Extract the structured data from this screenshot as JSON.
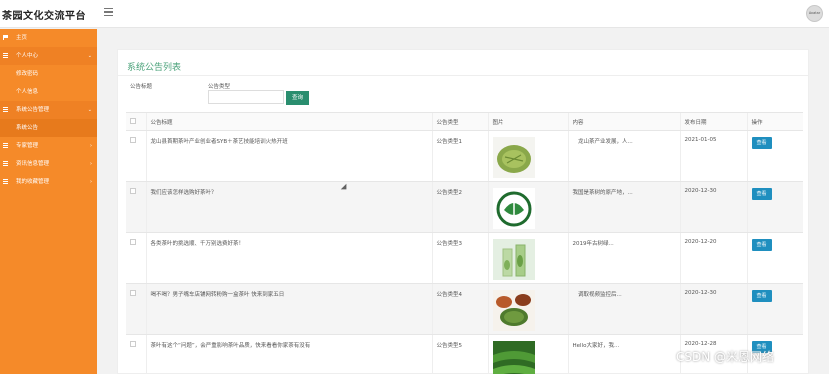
{
  "app": {
    "title": "茶园文化交流平台",
    "avatar_text": "Avatar"
  },
  "sidebar": {
    "items": [
      {
        "label": "主页",
        "icon": "flag-icon"
      },
      {
        "label": "个人中心",
        "icon": "grid-icon",
        "chevron": "⌄"
      },
      {
        "label": "修改密码"
      },
      {
        "label": "个人信息"
      },
      {
        "label": "系统公告管理",
        "icon": "grid-icon",
        "chevron": "⌄"
      },
      {
        "label": "系统公告"
      },
      {
        "label": "专家管理",
        "icon": "grid-icon",
        "chevron": "›"
      },
      {
        "label": "资讯信息管理",
        "icon": "grid-icon",
        "chevron": "›"
      },
      {
        "label": "我的收藏管理",
        "icon": "grid-icon",
        "chevron": "›"
      }
    ]
  },
  "main": {
    "title": "系统公告列表",
    "filters": {
      "title_label": "公告标题",
      "type_label": "公告类型",
      "search_label": "查询"
    },
    "table": {
      "headers": [
        "公告标题",
        "公告类型",
        "图片",
        "内容",
        "发布日期",
        "操作"
      ],
      "action_label": "查看",
      "rows": [
        {
          "title": "龙山县首期茶叶产业创业者SYB＋茶艺技能培训火热开班",
          "type": "公告类型1",
          "content": "　龙山茶产业发展，人...",
          "date": "2021-01-05"
        },
        {
          "title": "我们应该怎样选购好茶叶？",
          "type": "公告类型2",
          "content": "我国是茶树的原产地，...",
          "date": "2020-12-30"
        },
        {
          "title": "各类茶叶的挑选顺、千万别选费好茶！",
          "type": "公告类型3",
          "content": "2019年古树绿...",
          "date": "2020-12-20"
        },
        {
          "title": "喝不喝？男子嘴车店铺网转粉购一盒茶叶 快来到家五日",
          "type": "公告类型4",
          "content": "　调取视频监控后...",
          "date": "2020-12-30"
        },
        {
          "title": "茶叶有这个“问题”，会严重影响茶叶品质，快来看看你家茶有没有",
          "type": "公告类型5",
          "content": "Hello大家好，我...",
          "date": "2020-12-28"
        }
      ]
    }
  },
  "watermark": "CSDN @米恩网络",
  "colors": {
    "sidebar": "#f58a29",
    "accent_green": "#2a8e6f",
    "view_button": "#1f8fbf"
  }
}
